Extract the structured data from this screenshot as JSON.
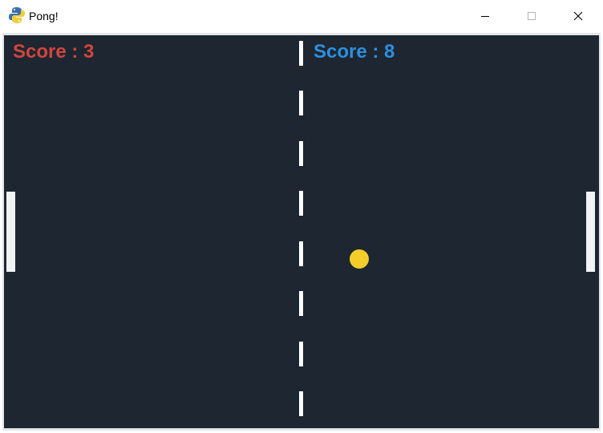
{
  "window": {
    "title": "Pong!",
    "icon": "python-snake-icon"
  },
  "caption_buttons": [
    "minimize-icon",
    "maximize-icon",
    "close-icon"
  ],
  "game": {
    "player_left": {
      "score_label": "Score",
      "separator": ":",
      "score": "3",
      "color": "#d2453c"
    },
    "player_right": {
      "score_label": "Score",
      "separator": ":",
      "score": "8",
      "color": "#2e8fde"
    },
    "ball_color": "#f4cd2a",
    "background_color": "#1d2631",
    "paddle_color": "#f1f3f5",
    "net_color": "#ffffff"
  }
}
